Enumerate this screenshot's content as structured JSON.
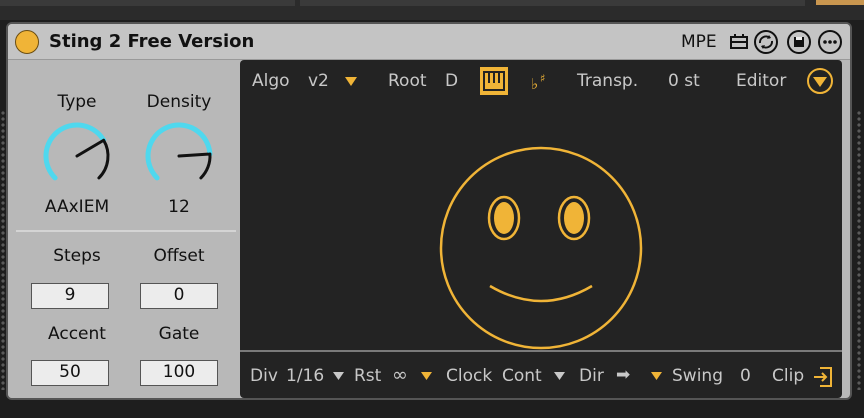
{
  "device": {
    "title": "Sting 2 Free Version",
    "mpe_label": "MPE"
  },
  "knobs": [
    {
      "label": "Type",
      "value": "AAxIEM",
      "level": 0.72
    },
    {
      "label": "Density",
      "value": "12",
      "level": 0.82
    }
  ],
  "numboxes": [
    {
      "label": "Steps",
      "value": "9"
    },
    {
      "label": "Offset",
      "value": "0"
    },
    {
      "label": "Accent",
      "value": "50"
    },
    {
      "label": "Gate",
      "value": "100"
    }
  ],
  "header": {
    "algo_label": "Algo",
    "algo_value": "v2",
    "root_label": "Root",
    "root_value": "D",
    "transp_label": "Transp.",
    "transp_value": "0 st",
    "editor_label": "Editor"
  },
  "footer": {
    "div_label": "Div",
    "div_value": "1/16",
    "rst_label": "Rst",
    "rst_value": "∞",
    "clock_label": "Clock",
    "clock_value": "Cont",
    "dir_label": "Dir",
    "dir_value": "➡",
    "swing_label": "Swing",
    "swing_value": "0",
    "clip_label": "Clip"
  },
  "colors": {
    "accent": "#f0b437",
    "knob_ring": "#4fd8ee",
    "screen_bg": "#232323",
    "device_bg": "#b8b8b8"
  },
  "icons": [
    "power-icon",
    "instrument-icon",
    "hot-swap-icon",
    "save-icon",
    "more-icon",
    "piano-icon",
    "flat-sharp-icon",
    "editor-chevron-icon",
    "clip-export-icon",
    "smiley-face-icon"
  ]
}
